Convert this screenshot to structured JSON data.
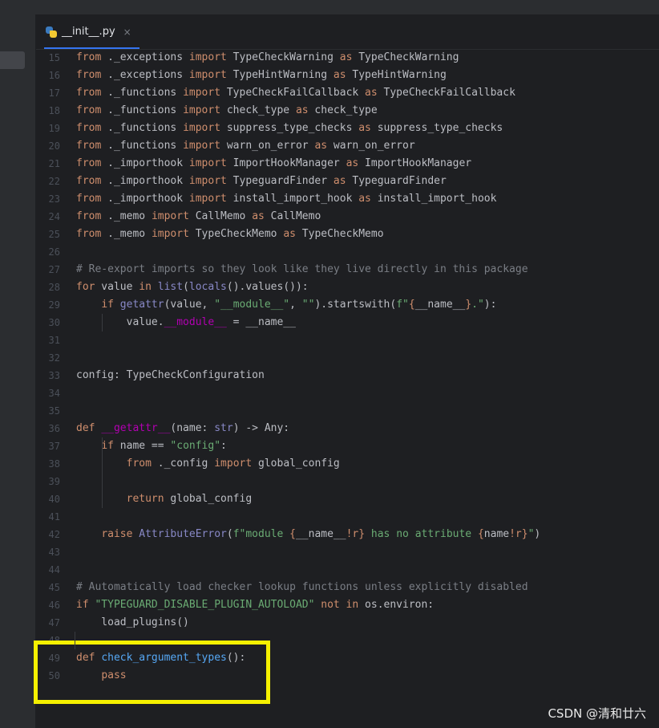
{
  "tab": {
    "filename": "__init__.py",
    "close_glyph": "×",
    "icon": "python-file-icon"
  },
  "lines": [
    {
      "n": "15",
      "tokens": [
        [
          "kw",
          "from"
        ],
        [
          "p",
          " ._exceptions "
        ],
        [
          "kw",
          "import"
        ],
        [
          "p",
          " TypeCheckWarning "
        ],
        [
          "kw",
          "as"
        ],
        [
          "p",
          " TypeCheckWarning"
        ]
      ]
    },
    {
      "n": "16",
      "tokens": [
        [
          "kw",
          "from"
        ],
        [
          "p",
          " ._exceptions "
        ],
        [
          "kw",
          "import"
        ],
        [
          "p",
          " TypeHintWarning "
        ],
        [
          "kw",
          "as"
        ],
        [
          "p",
          " TypeHintWarning"
        ]
      ]
    },
    {
      "n": "17",
      "tokens": [
        [
          "kw",
          "from"
        ],
        [
          "p",
          " ._functions "
        ],
        [
          "kw",
          "import"
        ],
        [
          "p",
          " TypeCheckFailCallback "
        ],
        [
          "kw",
          "as"
        ],
        [
          "p",
          " TypeCheckFailCallback"
        ]
      ]
    },
    {
      "n": "18",
      "tokens": [
        [
          "kw",
          "from"
        ],
        [
          "p",
          " ._functions "
        ],
        [
          "kw",
          "import"
        ],
        [
          "p",
          " check_type "
        ],
        [
          "kw",
          "as"
        ],
        [
          "p",
          " check_type"
        ]
      ]
    },
    {
      "n": "19",
      "tokens": [
        [
          "kw",
          "from"
        ],
        [
          "p",
          " ._functions "
        ],
        [
          "kw",
          "import"
        ],
        [
          "p",
          " suppress_type_checks "
        ],
        [
          "kw",
          "as"
        ],
        [
          "p",
          " suppress_type_checks"
        ]
      ]
    },
    {
      "n": "20",
      "tokens": [
        [
          "kw",
          "from"
        ],
        [
          "p",
          " ._functions "
        ],
        [
          "kw",
          "import"
        ],
        [
          "p",
          " warn_on_error "
        ],
        [
          "kw",
          "as"
        ],
        [
          "p",
          " warn_on_error"
        ]
      ]
    },
    {
      "n": "21",
      "tokens": [
        [
          "kw",
          "from"
        ],
        [
          "p",
          " ._importhook "
        ],
        [
          "kw",
          "import"
        ],
        [
          "p",
          " ImportHookManager "
        ],
        [
          "kw",
          "as"
        ],
        [
          "p",
          " ImportHookManager"
        ]
      ]
    },
    {
      "n": "22",
      "tokens": [
        [
          "kw",
          "from"
        ],
        [
          "p",
          " ._importhook "
        ],
        [
          "kw",
          "import"
        ],
        [
          "p",
          " TypeguardFinder "
        ],
        [
          "kw",
          "as"
        ],
        [
          "p",
          " TypeguardFinder"
        ]
      ]
    },
    {
      "n": "23",
      "tokens": [
        [
          "kw",
          "from"
        ],
        [
          "p",
          " ._importhook "
        ],
        [
          "kw",
          "import"
        ],
        [
          "p",
          " install_import_hook "
        ],
        [
          "kw",
          "as"
        ],
        [
          "p",
          " install_import_hook"
        ]
      ]
    },
    {
      "n": "24",
      "tokens": [
        [
          "kw",
          "from"
        ],
        [
          "p",
          " ._memo "
        ],
        [
          "kw",
          "import"
        ],
        [
          "p",
          " CallMemo "
        ],
        [
          "kw",
          "as"
        ],
        [
          "p",
          " CallMemo"
        ]
      ]
    },
    {
      "n": "25",
      "tokens": [
        [
          "kw",
          "from"
        ],
        [
          "p",
          " ._memo "
        ],
        [
          "kw",
          "import"
        ],
        [
          "p",
          " TypeCheckMemo "
        ],
        [
          "kw",
          "as"
        ],
        [
          "p",
          " TypeCheckMemo"
        ]
      ]
    },
    {
      "n": "26",
      "tokens": []
    },
    {
      "n": "27",
      "tokens": [
        [
          "cm",
          "# Re-export imports so they look like they live directly in this package"
        ]
      ]
    },
    {
      "n": "28",
      "tokens": [
        [
          "kw",
          "for"
        ],
        [
          "p",
          " value "
        ],
        [
          "kw",
          "in"
        ],
        [
          "p",
          " "
        ],
        [
          "bi",
          "list"
        ],
        [
          "p",
          "("
        ],
        [
          "bi",
          "locals"
        ],
        [
          "p",
          "().values()):"
        ]
      ]
    },
    {
      "n": "29",
      "tokens": [
        [
          "p",
          "    "
        ],
        [
          "kw",
          "if"
        ],
        [
          "p",
          " "
        ],
        [
          "bi",
          "getattr"
        ],
        [
          "p",
          "(value, "
        ],
        [
          "st",
          "\"__module__\""
        ],
        [
          "p",
          ", "
        ],
        [
          "st",
          "\"\""
        ],
        [
          "p",
          ").startswith("
        ],
        [
          "st",
          "f\""
        ],
        [
          "kw",
          "{"
        ],
        [
          "p",
          "__name__"
        ],
        [
          "kw",
          "}"
        ],
        [
          "st",
          ".\""
        ],
        [
          "p",
          "):"
        ]
      ]
    },
    {
      "n": "30",
      "tokens": [
        [
          "p",
          "        value."
        ],
        [
          "dn",
          "__module__"
        ],
        [
          "p",
          " = __name__"
        ]
      ]
    },
    {
      "n": "31",
      "tokens": []
    },
    {
      "n": "32",
      "tokens": []
    },
    {
      "n": "33",
      "tokens": [
        [
          "p",
          "config: TypeCheckConfiguration"
        ]
      ]
    },
    {
      "n": "34",
      "tokens": []
    },
    {
      "n": "35",
      "tokens": []
    },
    {
      "n": "36",
      "tokens": [
        [
          "kw",
          "def"
        ],
        [
          "p",
          " "
        ],
        [
          "dn",
          "__getattr__"
        ],
        [
          "p",
          "(name: "
        ],
        [
          "bi",
          "str"
        ],
        [
          "p",
          ") -> Any:"
        ]
      ]
    },
    {
      "n": "37",
      "tokens": [
        [
          "p",
          "    "
        ],
        [
          "kw",
          "if"
        ],
        [
          "p",
          " name == "
        ],
        [
          "st",
          "\"config\""
        ],
        [
          "p",
          ":"
        ]
      ]
    },
    {
      "n": "38",
      "tokens": [
        [
          "p",
          "        "
        ],
        [
          "kw",
          "from"
        ],
        [
          "p",
          " ._config "
        ],
        [
          "kw",
          "import"
        ],
        [
          "p",
          " global_config"
        ]
      ]
    },
    {
      "n": "39",
      "tokens": []
    },
    {
      "n": "40",
      "tokens": [
        [
          "p",
          "        "
        ],
        [
          "kw",
          "return"
        ],
        [
          "p",
          " global_config"
        ]
      ]
    },
    {
      "n": "41",
      "tokens": []
    },
    {
      "n": "42",
      "tokens": [
        [
          "p",
          "    "
        ],
        [
          "kw",
          "raise"
        ],
        [
          "p",
          " "
        ],
        [
          "bi",
          "AttributeError"
        ],
        [
          "p",
          "("
        ],
        [
          "st",
          "f\"module "
        ],
        [
          "kw",
          "{"
        ],
        [
          "p",
          "__name__"
        ],
        [
          "kw",
          "!r}"
        ],
        [
          "st",
          " has no attribute "
        ],
        [
          "kw",
          "{"
        ],
        [
          "p",
          "name"
        ],
        [
          "kw",
          "!r}"
        ],
        [
          "st",
          "\""
        ],
        [
          "p",
          ")"
        ]
      ]
    },
    {
      "n": "43",
      "tokens": []
    },
    {
      "n": "44",
      "tokens": []
    },
    {
      "n": "45",
      "tokens": [
        [
          "cm",
          "# Automatically load checker lookup functions unless explicitly disabled"
        ]
      ]
    },
    {
      "n": "46",
      "tokens": [
        [
          "kw",
          "if"
        ],
        [
          "p",
          " "
        ],
        [
          "st",
          "\"TYPEGUARD_DISABLE_PLUGIN_AUTOLOAD\""
        ],
        [
          "p",
          " "
        ],
        [
          "kw",
          "not in"
        ],
        [
          "p",
          " os.environ:"
        ]
      ]
    },
    {
      "n": "47",
      "tokens": [
        [
          "p",
          "    load_plugins()"
        ]
      ]
    },
    {
      "n": "48",
      "tokens": []
    },
    {
      "n": "49",
      "tokens": [
        [
          "kw",
          "def"
        ],
        [
          "p",
          " "
        ],
        [
          "fn",
          "check_argument_types"
        ],
        [
          "p",
          "():"
        ]
      ]
    },
    {
      "n": "50",
      "tokens": [
        [
          "p",
          "    "
        ],
        [
          "kw",
          "pass"
        ]
      ]
    }
  ],
  "watermark": "CSDN @清和廿六"
}
